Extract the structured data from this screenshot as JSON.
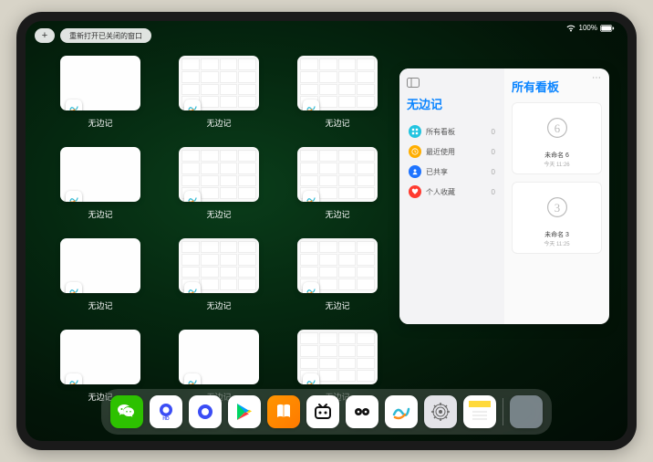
{
  "status": {
    "battery_text": "100%"
  },
  "top": {
    "plus": "+",
    "reopen_label": "重新打开已关闭的窗口"
  },
  "switcher": {
    "app_label": "无边记",
    "cards": [
      {
        "style": "blank"
      },
      {
        "style": "grid"
      },
      {
        "style": "grid"
      },
      {
        "style": "blank"
      },
      {
        "style": "grid"
      },
      {
        "style": "grid"
      },
      {
        "style": "blank"
      },
      {
        "style": "grid"
      },
      {
        "style": "grid"
      },
      {
        "style": "blank"
      },
      {
        "style": "blank"
      },
      {
        "style": "grid"
      }
    ]
  },
  "panel": {
    "left_title": "无边记",
    "right_title": "所有看板",
    "more": "⋯",
    "menu": [
      {
        "icon": "grid",
        "color": "#22c4e0",
        "label": "所有看板",
        "count": "0"
      },
      {
        "icon": "clock",
        "color": "#ffae00",
        "label": "最近使用",
        "count": "0"
      },
      {
        "icon": "people",
        "color": "#1e73ff",
        "label": "已共享",
        "count": "0"
      },
      {
        "icon": "heart",
        "color": "#ff3b30",
        "label": "个人收藏",
        "count": "0"
      }
    ],
    "boards": [
      {
        "name": "未命名 6",
        "date": "今天 11:26",
        "digit": "6"
      },
      {
        "name": "未命名 3",
        "date": "今天 11:25",
        "digit": "3"
      }
    ]
  },
  "dock": [
    "wechat",
    "quark-hd",
    "quark",
    "playstore",
    "books",
    "bilibili",
    "ximalaya",
    "freeform",
    "settings",
    "notes",
    "folder"
  ]
}
